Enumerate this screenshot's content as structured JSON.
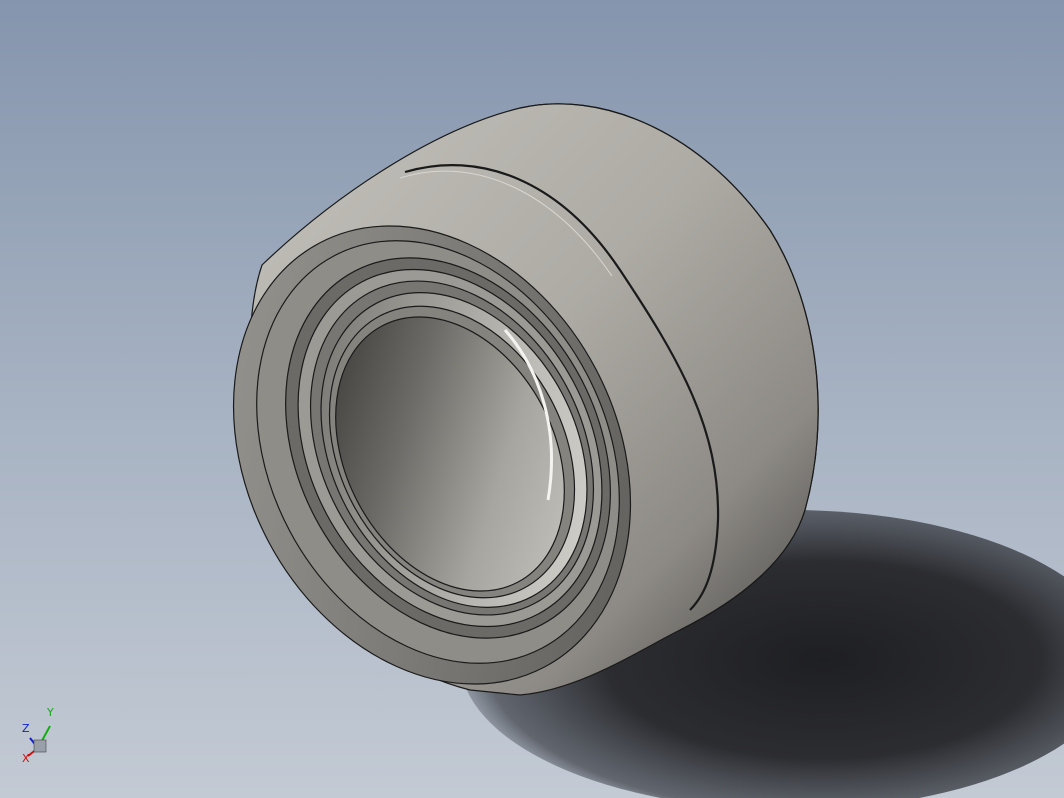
{
  "viewport": {
    "background_top": "#8595ad",
    "background_bottom": "#c3cad4"
  },
  "model": {
    "part": "bearing-icon",
    "body_color": "#a8a6a1",
    "edge_color": "#1a1a1a",
    "shadow_color": "#2a2b2e"
  },
  "triad": {
    "x_label": "X",
    "y_label": "Y",
    "z_label": "Z",
    "x_color": "#d01010",
    "y_color": "#10b010",
    "z_color": "#1020d0"
  }
}
